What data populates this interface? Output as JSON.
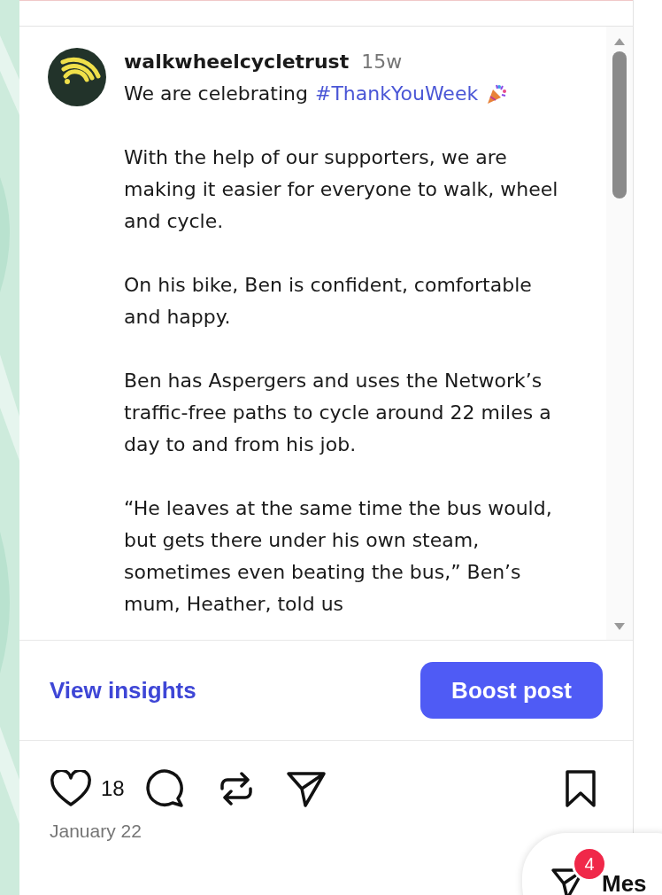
{
  "post": {
    "author": "walkwheelcycletrust",
    "time": "15w",
    "intro": "We are celebrating",
    "hashtag": "#ThankYouWeek",
    "paragraphs": [
      "With the help of our supporters, we are making it easier for everyone to walk, wheel and cycle.",
      "On his bike, Ben is confident, comfortable and happy.",
      "Ben has Aspergers and uses the Network’s traffic-free paths to cycle around 22 miles a day to and from his job.",
      "“He leaves at the same time the bus would, but gets there under his own steam, sometimes even beating the bus,” Ben’s mum, Heather, told us"
    ]
  },
  "actions": {
    "insights_link": "View insights",
    "boost_button": "Boost post"
  },
  "engagement": {
    "like_count": "18",
    "date": "January 22"
  },
  "messages": {
    "badge": "4",
    "label": "Mes"
  }
}
